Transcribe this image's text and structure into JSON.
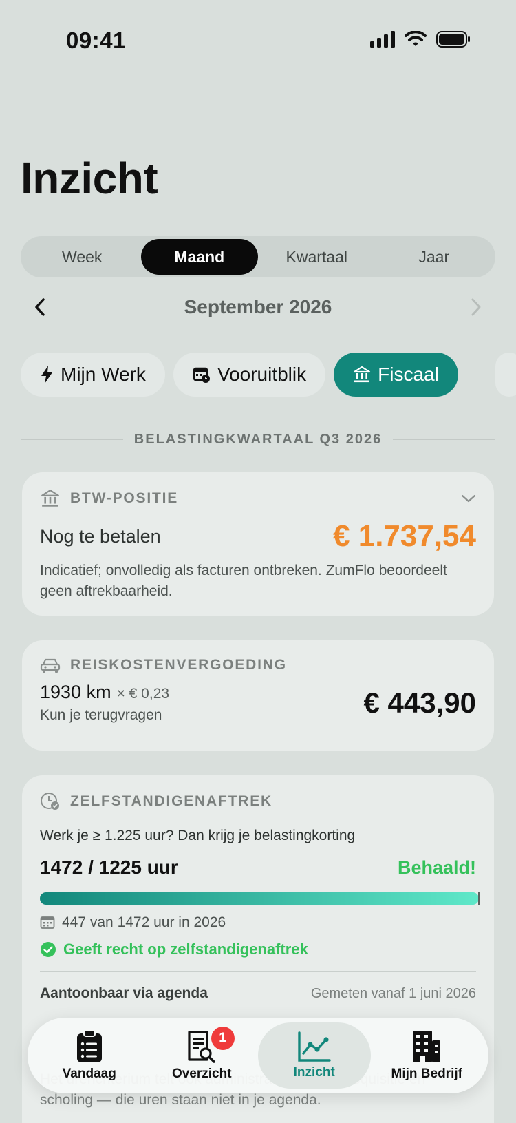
{
  "status": {
    "time": "09:41"
  },
  "page": {
    "title": "Inzicht"
  },
  "period_tabs": [
    "Week",
    "Maand",
    "Kwartaal",
    "Jaar"
  ],
  "period_tabs_active": "Maand",
  "period": {
    "label": "September 2026"
  },
  "chips": [
    {
      "label": "Mijn Werk",
      "icon": "bolt-icon"
    },
    {
      "label": "Vooruitblik",
      "icon": "calendar-clock-icon"
    },
    {
      "label": "Fiscaal",
      "icon": "bank-icon",
      "active": true
    }
  ],
  "section": {
    "title": "BELASTINGKWARTAAL Q3 2026"
  },
  "btw": {
    "title": "BTW-POSITIE",
    "label": "Nog te betalen",
    "amount": "€ 1.737,54",
    "note": "Indicatief; onvolledig als facturen ontbreken. ZumFlo beoordeelt geen aftrekbaarheid."
  },
  "reiskosten": {
    "title": "REISKOSTENVERGOEDING",
    "km": "1930 km",
    "rate": "× € 0,23",
    "sub": "Kun je terugvragen",
    "amount": "€ 443,90"
  },
  "zelfstandig": {
    "title": "ZELFSTANDIGENAFTREK",
    "question": "Werk je ≥ 1.225 uur? Dan krijg je belastingkorting",
    "hours": "1472 / 1225 uur",
    "status": "Behaald!",
    "progress": 1.0,
    "year_note": "447 van 1472 uur in 2026",
    "entitled": "Geeft recht op zelfstandigenaftrek",
    "agenda_label": "Aantoonbaar via agenda",
    "agenda_measured": "Gemeten vanaf 1 juni 2026",
    "footnote": "Het urencriterium telt ook administratie, reistijd, acquisitie en scholing — die uren staan niet in je agenda."
  },
  "tabbar": {
    "items": [
      {
        "label": "Vandaag",
        "icon": "clipboard-list-icon"
      },
      {
        "label": "Overzicht",
        "icon": "document-search-icon",
        "badge": "1"
      },
      {
        "label": "Inzicht",
        "icon": "line-chart-icon",
        "active": true
      },
      {
        "label": "Mijn Bedrijf",
        "icon": "building-icon"
      }
    ]
  },
  "colors": {
    "accent": "#12877b",
    "orange": "#f08a2c",
    "success": "#35c15b",
    "badge": "#ef3b3b"
  }
}
